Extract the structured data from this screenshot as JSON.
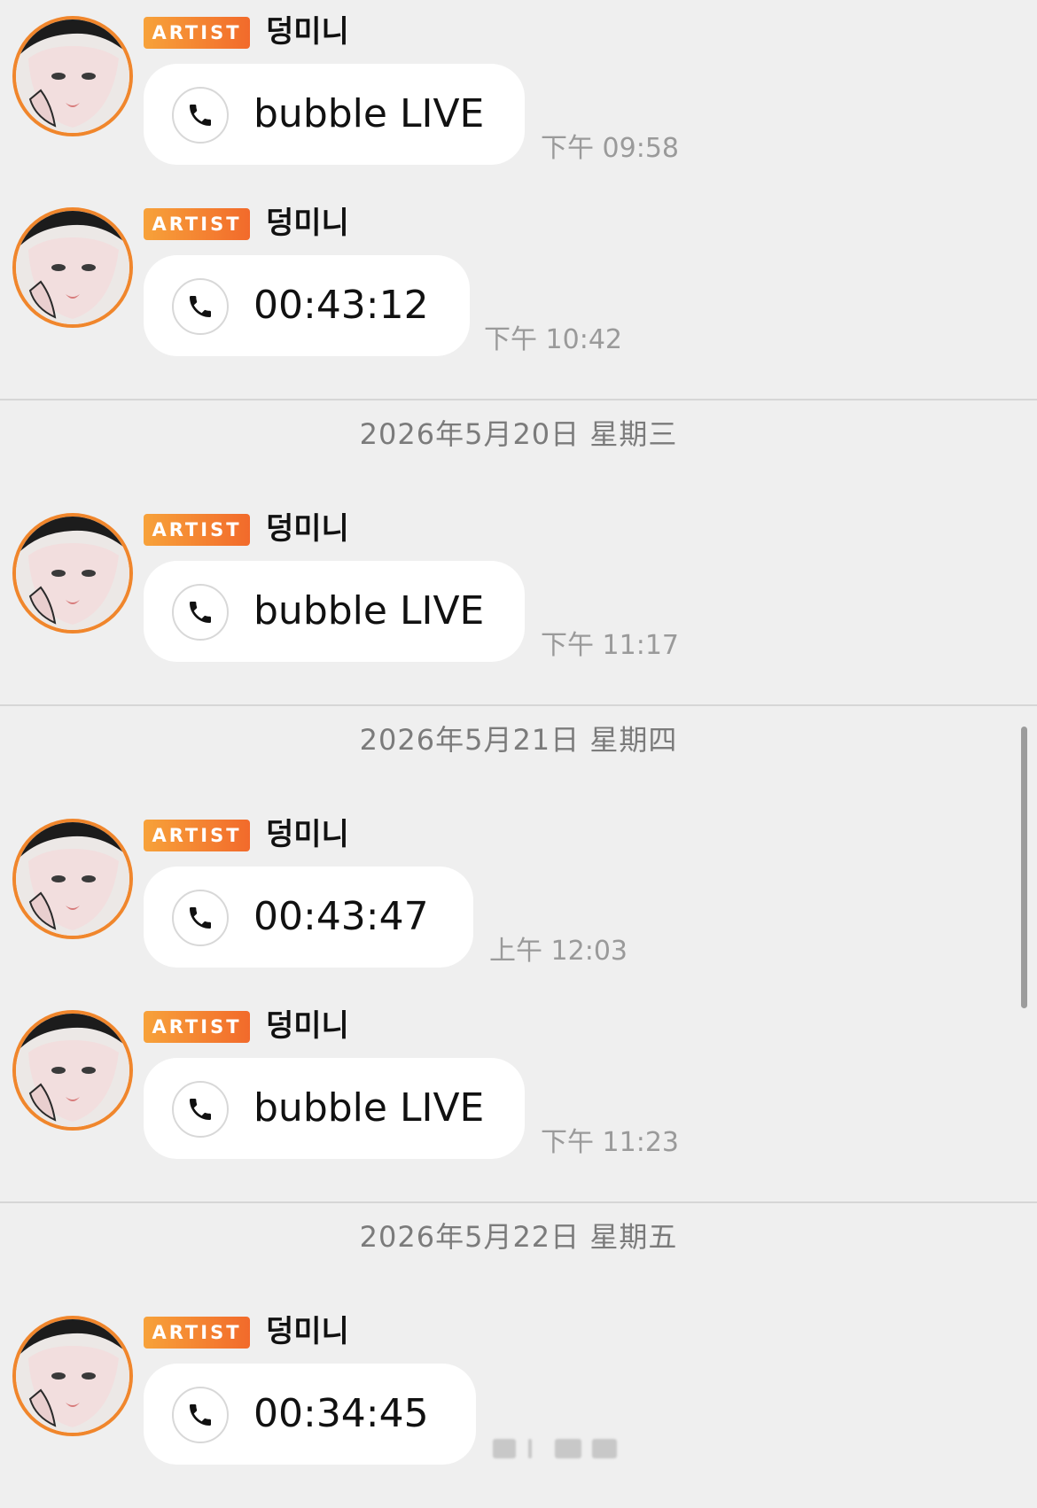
{
  "colors": {
    "background": "#efefef",
    "bubble": "#ffffff",
    "badge_gradient_start": "#f7a23a",
    "badge_gradient_end": "#f26a2b",
    "avatar_ring": "#f0862c",
    "time_text": "#9a9a9a",
    "date_text": "#7b7b7b"
  },
  "messages": [
    {
      "badge": "ARTIST",
      "sender": "덩미니",
      "icon": "phone-icon",
      "text": "bubble LIVE",
      "time": "下午 09:58"
    },
    {
      "badge": "ARTIST",
      "sender": "덩미니",
      "icon": "phone-icon",
      "text": "00:43:12",
      "time": "下午 10:42"
    },
    {
      "badge": "ARTIST",
      "sender": "덩미니",
      "icon": "phone-icon",
      "text": "bubble LIVE",
      "time": "下午 11:17"
    },
    {
      "badge": "ARTIST",
      "sender": "덩미니",
      "icon": "phone-icon",
      "text": "00:43:47",
      "time": "上午 12:03"
    },
    {
      "badge": "ARTIST",
      "sender": "덩미니",
      "icon": "phone-icon",
      "text": "bubble LIVE",
      "time": "下午 11:23"
    },
    {
      "badge": "ARTIST",
      "sender": "덩미니",
      "icon": "phone-icon",
      "text": "00:34:45",
      "time": ""
    }
  ],
  "date_separators": [
    "2026年5月20日 星期三",
    "2026年5月21日 星期四",
    "2026年5月22日 星期五"
  ]
}
